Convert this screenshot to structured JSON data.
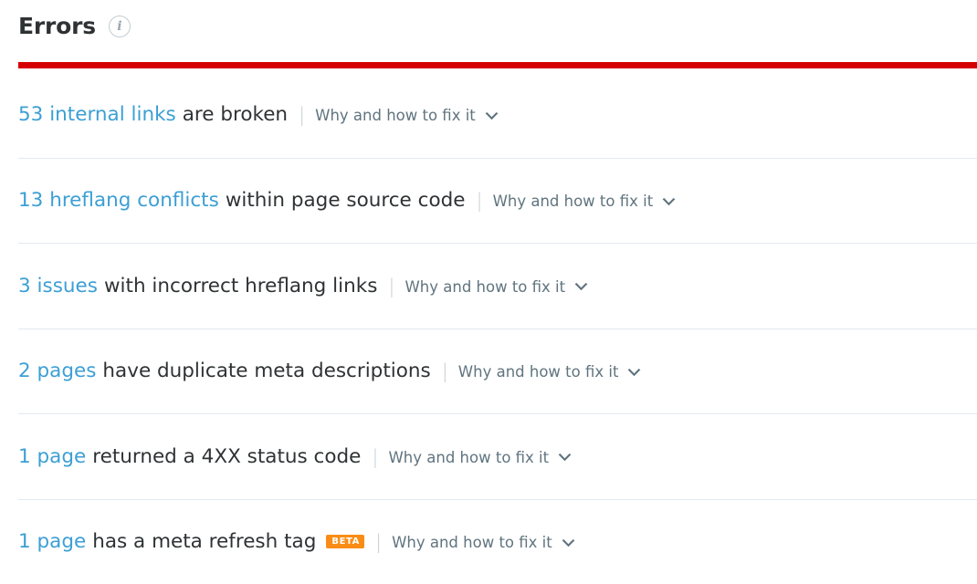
{
  "header": {
    "title": "Errors",
    "info_icon": "info-icon",
    "info_glyph": "i"
  },
  "severity": {
    "color": "#d50000"
  },
  "colors": {
    "link": "#3c9fd5",
    "text": "#2f3234",
    "muted": "#60747f",
    "divider": "#e3e9ef",
    "badge": "#fa8c16",
    "severity_bar": "#d50000"
  },
  "issues": [
    {
      "count": "53 internal links",
      "description": "are broken",
      "separator": "|",
      "fix_label": "Why and how to fix it",
      "chevron": "chevron-down-icon",
      "badge": ""
    },
    {
      "count": "13 hreflang conflicts",
      "description": "within page source code",
      "separator": "|",
      "fix_label": "Why and how to fix it",
      "chevron": "chevron-down-icon",
      "badge": ""
    },
    {
      "count": "3 issues",
      "description": "with incorrect hreflang links",
      "separator": "|",
      "fix_label": "Why and how to fix it",
      "chevron": "chevron-down-icon",
      "badge": ""
    },
    {
      "count": "2 pages",
      "description": "have duplicate meta descriptions",
      "separator": "|",
      "fix_label": "Why and how to fix it",
      "chevron": "chevron-down-icon",
      "badge": ""
    },
    {
      "count": "1 page",
      "description": "returned a 4XX status code",
      "separator": "|",
      "fix_label": "Why and how to fix it",
      "chevron": "chevron-down-icon",
      "badge": ""
    },
    {
      "count": "1 page",
      "description": "has a meta refresh tag",
      "separator": "|",
      "fix_label": "Why and how to fix it",
      "chevron": "chevron-down-icon",
      "badge": "BETA"
    }
  ]
}
